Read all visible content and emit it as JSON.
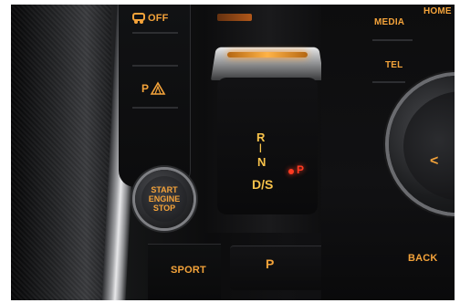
{
  "controls": {
    "off_label": "OFF",
    "park_assist_label": "P",
    "start_lines": [
      "START",
      "ENGINE",
      "STOP"
    ],
    "sport_label": "SPORT",
    "gear_r": "R",
    "gear_n": "N",
    "gear_ds": "D/S",
    "gear_p": "P",
    "park_button_label": "P",
    "media_label": "MEDIA",
    "home_label": "HOME",
    "tel_label": "TEL",
    "back_label": "BACK",
    "knob_arrow": "<"
  },
  "colors": {
    "label_amber": "#f4a33a",
    "park_red": "#ff3b22"
  },
  "icons": [
    "traction-off-icon",
    "park-assist-icon",
    "chevron-left-icon"
  ]
}
